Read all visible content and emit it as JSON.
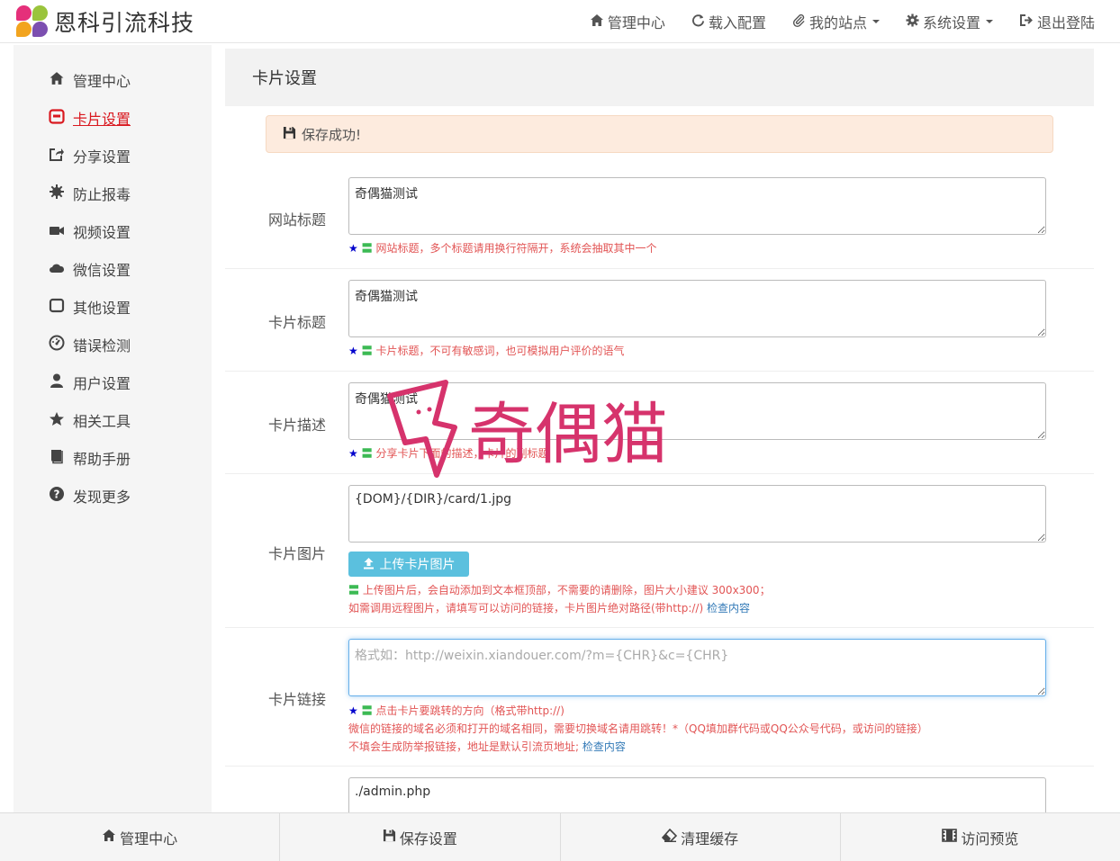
{
  "brand": {
    "name": "恩科引流科技"
  },
  "topnav": [
    {
      "label": "管理中心",
      "icon": "home-icon"
    },
    {
      "label": "载入配置",
      "icon": "refresh-icon"
    },
    {
      "label": "我的站点",
      "icon": "paperclip-icon",
      "dropdown": true
    },
    {
      "label": "系统设置",
      "icon": "gear-icon",
      "dropdown": true
    },
    {
      "label": "退出登陆",
      "icon": "logout-icon"
    }
  ],
  "sidebar": {
    "items": [
      {
        "label": "管理中心",
        "icon": "home-icon"
      },
      {
        "label": "卡片设置",
        "icon": "card-icon",
        "active": true
      },
      {
        "label": "分享设置",
        "icon": "share-icon"
      },
      {
        "label": "防止报毒",
        "icon": "virus-icon"
      },
      {
        "label": "视频设置",
        "icon": "video-icon"
      },
      {
        "label": "微信设置",
        "icon": "cloud-icon"
      },
      {
        "label": "其他设置",
        "icon": "square-icon"
      },
      {
        "label": "错误检测",
        "icon": "dashboard-icon"
      },
      {
        "label": "用户设置",
        "icon": "user-icon"
      },
      {
        "label": "相关工具",
        "icon": "star-icon"
      },
      {
        "label": "帮助手册",
        "icon": "book-icon"
      },
      {
        "label": "发现更多",
        "icon": "question-icon"
      }
    ]
  },
  "panel": {
    "title": "卡片设置"
  },
  "alert": {
    "text": "保存成功!"
  },
  "form": {
    "site_title": {
      "label": "网站标题",
      "value": "奇偶猫测试",
      "help": "网站标题，多个标题请用换行符隔开，系统会抽取其中一个"
    },
    "card_title": {
      "label": "卡片标题",
      "value": "奇偶猫测试",
      "help": "卡片标题，不可有敏感词，也可模拟用户评价的语气"
    },
    "card_desc": {
      "label": "卡片描述",
      "value": "奇偶猫测试",
      "help": "分享卡片下面的描述，卡片的副标题"
    },
    "card_image": {
      "label": "卡片图片",
      "value": "{DOM}/{DIR}/card/1.jpg",
      "upload_label": "上传卡片图片",
      "help1": "上传图片后，会自动添加到文本框顶部，不需要的请删除，图片大小建议 300x300；",
      "help2": "如需调用远程图片，请填写可以访问的链接，卡片图片绝对路径(带http://)",
      "check_link": "检查内容"
    },
    "card_link": {
      "label": "卡片链接",
      "value": "",
      "placeholder": "格式如：http://weixin.xiandouer.com/?m={CHR}&c={CHR}",
      "help1": "点击卡片要跳转的方向（格式带http://)",
      "help2": "微信的链接的域名必须和打开的域名相同，需要切换域名请用跳转！*（QQ填加群代码或QQ公众号代码，或访问的链接）",
      "help3": "不填会生成防举报链接，地址是默认引流页地址;",
      "check_link": "检查内容"
    },
    "next_field": {
      "value": "./admin.php"
    }
  },
  "watermark": {
    "text": "奇偶猫"
  },
  "footer": [
    {
      "label": "管理中心",
      "icon": "home-icon"
    },
    {
      "label": "保存设置",
      "icon": "save-icon"
    },
    {
      "label": "清理缓存",
      "icon": "eraser-icon"
    },
    {
      "label": "访问预览",
      "icon": "film-icon"
    }
  ],
  "colors": {
    "accent": "#d9181f",
    "info_button": "#5bc0de",
    "alert_bg": "#fdebde",
    "help_text": "#e25555"
  }
}
